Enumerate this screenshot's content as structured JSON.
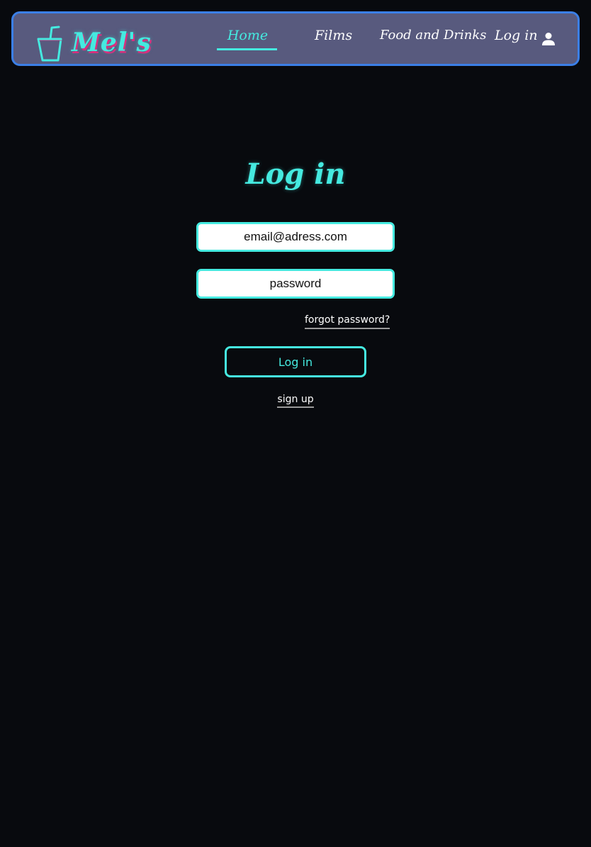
{
  "nav": {
    "logo_text": "Mel's",
    "links": [
      {
        "label": "Home",
        "active": true
      },
      {
        "label": "Films"
      },
      {
        "label": "Food and Drinks"
      },
      {
        "label": "Log in"
      }
    ],
    "user_icon": "user-icon",
    "logo_icon": "drink-cup-icon"
  },
  "login": {
    "title": "Log in",
    "email_placeholder": "email@adress.com",
    "password_placeholder": "password",
    "forgot_label": "forgot password?",
    "submit_label": "Log in",
    "signup_label": "sign up"
  },
  "colors": {
    "background": "#080a0e",
    "navbar": "#585a7e",
    "navbar_border": "#3b7fe6",
    "accent": "#45eae0",
    "logo_shadow": "#d8307e"
  }
}
